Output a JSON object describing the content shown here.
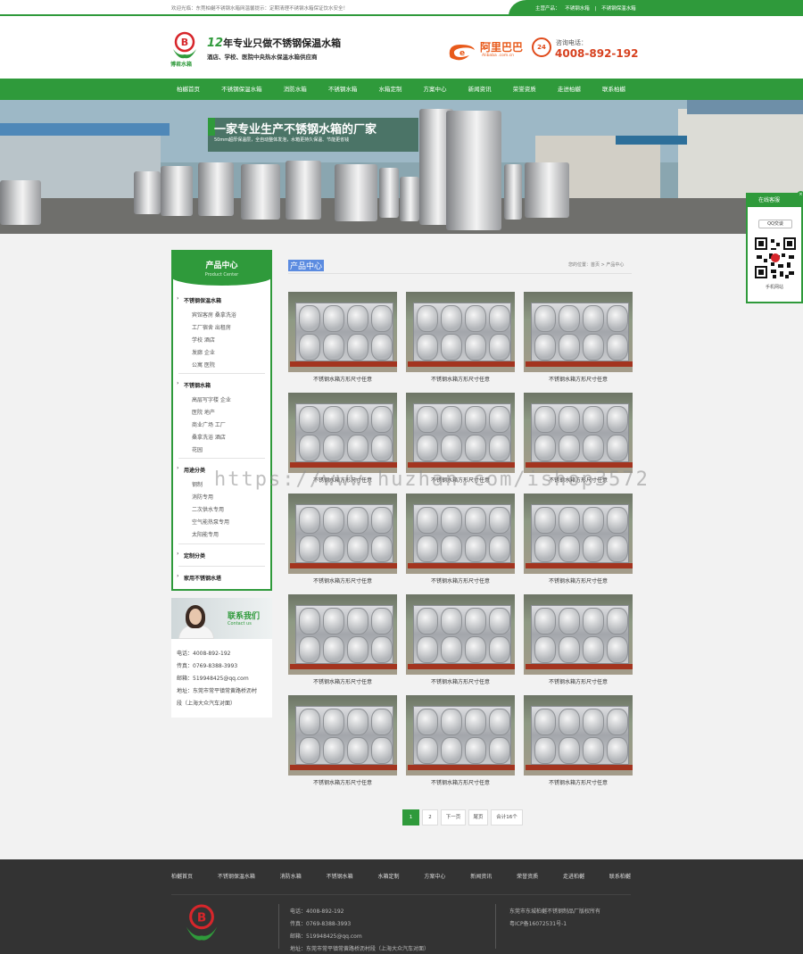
{
  "topbar": {
    "welcome": "欢迎光临：东莞柏樾不锈钢水箱网温馨提示：定期清理不锈钢水箱保证饮水安全！",
    "links": [
      "主营产品：",
      "不锈钢水箱",
      "|",
      "不锈钢保温水箱"
    ]
  },
  "header": {
    "logo_text": "博君水箱",
    "slogan_num": "12",
    "slogan_main": "年专业只做不锈钢保温水箱",
    "slogan_sub": "酒店、学校、医院中央热水保温水箱供应商",
    "ali_cn": "阿里巴巴",
    "ali_en": "Alibaba .com.cn",
    "badge": "24",
    "phone_label": "咨询电话：",
    "phone": "4008-892-192"
  },
  "nav": [
    "柏樾首页",
    "不锈钢保温水箱",
    "消防水箱",
    "不锈钢水箱",
    "水箱定制",
    "方案中心",
    "新闻资讯",
    "荣誉资质",
    "走进柏樾",
    "联系柏樾"
  ],
  "banner": {
    "headline": "一家专业生产不锈钢水箱的厂家",
    "subline": "50mm超厚保温层，全自动整体发泡，水箱更持久保温、节能更省钱"
  },
  "qq": {
    "title": "在线客服",
    "close": "×",
    "button": "QQ交谈",
    "footer": "手机网站"
  },
  "sidebar": {
    "title": "产品中心",
    "subtitle": "Product Center",
    "cats": [
      {
        "label": "不锈钢保温水箱",
        "subs": [
          "宾馆客房  桑拿洗浴",
          "工厂宿舍  出租房",
          "学校  酒店",
          "发廊  企业",
          "公寓  医院"
        ]
      },
      {
        "label": "不锈钢水箱",
        "subs": [
          "高层写字楼  企业",
          "医院  地产",
          "商业广场  工厂",
          "桑拿洗浴  酒店",
          "花园"
        ]
      },
      {
        "label": "用途分类",
        "subs": [
          "钢制",
          "消防专用",
          "二次供水专用",
          "空气能热泵专用",
          "太阳能专用"
        ]
      },
      {
        "label": "定制分类",
        "subs": []
      },
      {
        "label": "家用不锈钢水塔",
        "subs": []
      }
    ]
  },
  "contact": {
    "title": "联系我们",
    "subtitle": "Contact us",
    "lines": [
      "电话：4008-892-192",
      "传真：0769-8388-3993",
      "邮箱：519948425@qq.com",
      "地址：东莞市常平镇常黄路桥沥村",
      "段（上海大众汽车对面）"
    ]
  },
  "main": {
    "title": "产品中心",
    "breadcrumb": "您的位置：首页 > 产品中心",
    "product_caption": "不锈钢水箱方形尺寸任意",
    "product_count": 15
  },
  "pager": {
    "items": [
      "1",
      "2",
      "下一页",
      "尾页",
      "合计16个"
    ],
    "active": "1"
  },
  "watermark": "https://www.huzhan.com/ishop3572",
  "footer": {
    "nav": [
      "柏樾首页",
      "不锈钢保温水箱",
      "消防水箱",
      "不锈钢水箱",
      "水箱定制",
      "方案中心",
      "新闻资讯",
      "荣誉资质",
      "走进柏樾",
      "联系柏樾"
    ],
    "info": [
      "电话：4008-892-192",
      "传真：0769-8388-3993",
      "邮箱：519948425@qq.com",
      "地址：东莞市常平镇常黄路桥沥村段（上海大众汽车对面）"
    ],
    "right": [
      "东莞市东城柏樾不锈钢制品厂版权所有",
      "粤ICP备16072531号-1"
    ]
  },
  "colors": {
    "brand_green": "#2f9a3b",
    "phone_red": "#d7411f"
  }
}
